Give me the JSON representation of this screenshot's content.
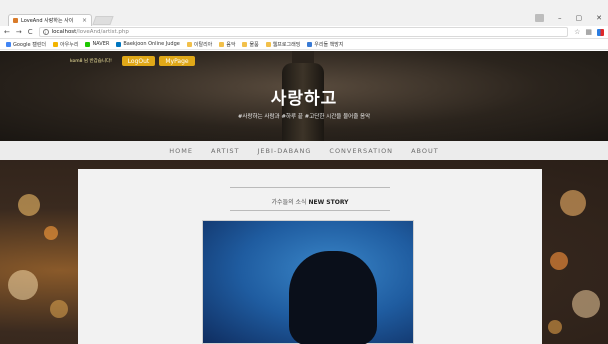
{
  "browser": {
    "tab_title": "LoveAnd 사랑하는 사이",
    "tab_close": "×",
    "url_host": "localhost",
    "url_path": "/loveAnd/artist.php",
    "nav": {
      "back": "←",
      "forward": "→",
      "reload": "C"
    },
    "bookmarks": [
      {
        "label": "Google 캘린더",
        "color": "#4285f4"
      },
      {
        "label": "아우누리",
        "color": "#f2b400"
      },
      {
        "label": "NAVER",
        "color": "#1ec800"
      },
      {
        "label": "Baekjoon Online Judge",
        "color": "#0076c0"
      },
      {
        "label": "이탈리아",
        "color": "#f2c04a"
      },
      {
        "label": "음악",
        "color": "#f2c04a"
      },
      {
        "label": "물품",
        "color": "#f2c04a"
      },
      {
        "label": "웹프로그래밍",
        "color": "#f2c04a"
      },
      {
        "label": "우리들 책방지",
        "color": "#3a7bd5"
      }
    ]
  },
  "header": {
    "greeting": "kom8 님 반갑습니다!",
    "logout_label": "LogOut",
    "mypage_label": "MyPage",
    "logo": "사랑하고",
    "tagline": "#사랑하는 사람과 #하루 끝 #고단한 시간을 물어줄 음악"
  },
  "menu": [
    "HOME",
    "ARTIST",
    "JEBI-DABANG",
    "CONVERSATION",
    "ABOUT"
  ],
  "main": {
    "section_title_kr": "가수들의 소식",
    "section_title_en": "NEW STORY"
  },
  "colors": {
    "accent": "#e0a818",
    "menu_bg": "#ececec",
    "photo_blue": "#1f5ca0"
  }
}
